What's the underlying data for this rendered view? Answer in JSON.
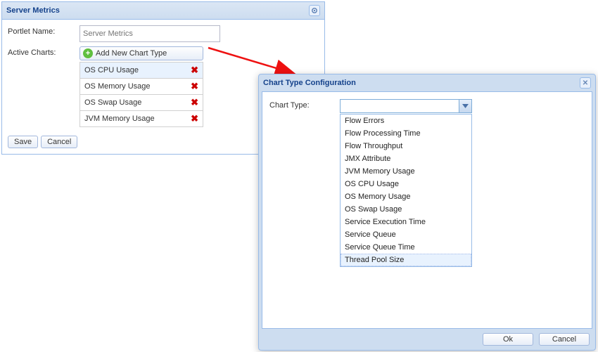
{
  "panel": {
    "title": "Server Metrics",
    "portlet_label": "Portlet Name:",
    "portlet_placeholder": "Server Metrics",
    "active_charts_label": "Active Charts:",
    "add_btn": "Add New Chart Type",
    "charts": [
      {
        "label": "OS CPU Usage"
      },
      {
        "label": "OS Memory Usage"
      },
      {
        "label": "OS Swap Usage"
      },
      {
        "label": "JVM Memory Usage"
      }
    ],
    "save": "Save",
    "cancel": "Cancel"
  },
  "dialog": {
    "title": "Chart Type Configuration",
    "chart_type_label": "Chart Type:",
    "options": [
      "Flow Errors",
      "Flow Processing Time",
      "Flow Throughput",
      "JMX Attribute",
      "JVM Memory Usage",
      "OS CPU Usage",
      "OS Memory Usage",
      "OS Swap Usage",
      "Service Execution Time",
      "Service Queue",
      "Service Queue Time",
      "Thread Pool Size"
    ],
    "highlighted_index": 11,
    "ok": "Ok",
    "cancel": "Cancel"
  }
}
